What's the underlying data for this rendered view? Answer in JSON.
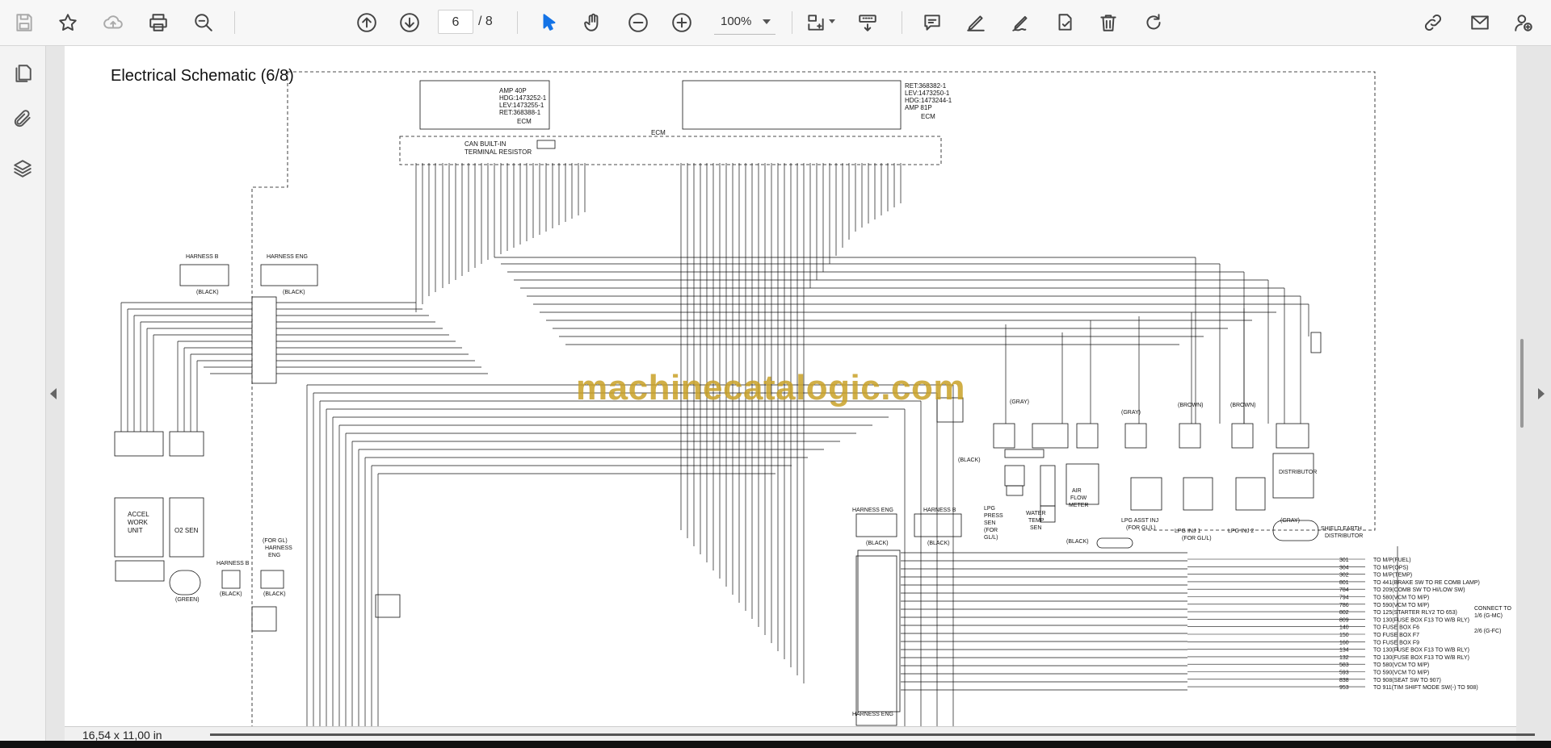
{
  "toolbar": {
    "page_current": "6",
    "page_total": "/ 8",
    "zoom": "100%",
    "icons": [
      "save-icon",
      "bookmark-star-icon",
      "cloud-upload-icon",
      "print-icon",
      "find-icon",
      "page-up-icon",
      "page-down-icon",
      "select-tool-icon",
      "hand-tool-icon",
      "zoom-out-icon",
      "zoom-in-icon",
      "fit-page-icon",
      "scroll-mode-icon",
      "comment-icon",
      "pen-icon",
      "sign-icon",
      "stamp-icon",
      "delete-icon",
      "rotate-icon",
      "share-link-icon",
      "email-icon",
      "add-user-icon"
    ]
  },
  "sidebar": {
    "items": [
      "pages-icon",
      "attachments-icon",
      "layers-icon"
    ]
  },
  "document": {
    "title": "Electrical Schematic (6/8)",
    "watermark": "machinecatalogic.com",
    "page_size": "16,54 x 11,00 in",
    "labels": {
      "amp40": "AMP 40P",
      "hdg1": "HDG:1473252-1",
      "lev1": "LEV:1473255-1",
      "ret1": "RET:368388-1",
      "ecm1": "ECM",
      "ret2": "RET:368382-1",
      "lev2": "LEV:1473250-1",
      "hdg2": "HDG:1473244-1",
      "amp81": "AMP 81P",
      "ecm2": "ECM",
      "ecm3": "ECM",
      "can1": "CAN BUILT-IN",
      "can2": "TERMINAL RESISTOR",
      "harness_b1": "HARNESS B",
      "harness_eng1": "HARNESS ENG",
      "black1": "(BLACK)",
      "black2": "(BLACK)",
      "accel1": "ACCEL",
      "accel2": "WORK",
      "accel3": "UNIT",
      "o2sen": "O2 SEN",
      "harness_b2": "HARNESS B",
      "black3": "(BLACK)",
      "forgl": "(FOR GL)",
      "harness2": "HARNESS",
      "eng2": "ENG",
      "black4": "(BLACK)",
      "green": "(GREEN)",
      "harness_eng3": "HARNESS ENG",
      "harness_b3": "HARNESS B",
      "black5": "(BLACK)",
      "black6": "(BLACK)",
      "harness_eng4": "HARNESS ENG",
      "gray1": "(GRAY)",
      "black7": "(BLACK)",
      "lpg_press1": "LPG",
      "lpg_press2": "PRESS",
      "lpg_press3": "SEN",
      "lpg_press4": "(FOR",
      "lpg_press5": "GL/L)",
      "water1": "WATER",
      "water2": "TEMP",
      "water3": "SEN",
      "air1": "AIR",
      "air2": "FLOW",
      "air3": "METER",
      "black8": "(BLACK)",
      "gray2": "(GRAY)",
      "lpg_asst1": "LPG ASST INJ",
      "lpg_asst2": "(FOR GL/L)",
      "brown1": "(BROWN)",
      "brown2": "(BROWN)",
      "lpg_inj1": "LPG INJ 1",
      "forgll": "(FOR GL/L)",
      "lpg_inj2": "LPG INJ 2",
      "distributor": "DISTRIBUTOR",
      "gray3": "(GRAY)",
      "shield1": "SHIELD EARTH",
      "shield2": "DISTRIBUTOR",
      "connect1": "CONNECT TO",
      "connect2": "1/6 (G-MC)",
      "connect3": "2/6 (G-FC)"
    },
    "connections": [
      {
        "num": "301",
        "dest": "TO M/P(FUEL)"
      },
      {
        "num": "304",
        "dest": "TO M/P(OPS)"
      },
      {
        "num": "302",
        "dest": "TO M/P(TEMP)"
      },
      {
        "num": "801",
        "dest": "TO 441(BRAKE SW TO RE COMB LAMP)"
      },
      {
        "num": "784",
        "dest": "TO 209(COMB SW TO HI/LOW SW)"
      },
      {
        "num": "794",
        "dest": "TO 580(VCM TO M/P)"
      },
      {
        "num": "786",
        "dest": "TO 590(VCM TO M/P)"
      },
      {
        "num": "802",
        "dest": "TO 125(STARTER RLY2 TO 653)"
      },
      {
        "num": "809",
        "dest": "TO 130(FUSE BOX F13 TO W/B RLY)"
      },
      {
        "num": "140",
        "dest": "TO FUSE BOX F6"
      },
      {
        "num": "150",
        "dest": "TO FUSE BOX F7"
      },
      {
        "num": "160",
        "dest": "TO FUSE BOX F9"
      },
      {
        "num": "134",
        "dest": "TO 130(FUSE BOX F13 TO W/B RLY)"
      },
      {
        "num": "132",
        "dest": "TO 130(FUSE BOX F13 TO W/B RLY)"
      },
      {
        "num": "583",
        "dest": "TO 580(VCM TO M/P)"
      },
      {
        "num": "593",
        "dest": "TO 590(VCM TO M/P)"
      },
      {
        "num": "838",
        "dest": "TO 908(SEAT SW TO 907)"
      },
      {
        "num": "953",
        "dest": "TO 911(TIM SHIFT MODE SW(-) TO 908)"
      }
    ]
  }
}
